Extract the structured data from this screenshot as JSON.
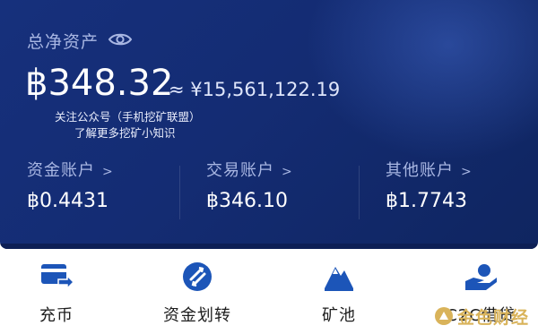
{
  "summary": {
    "total_label": "总净资产",
    "balance": "฿348.32",
    "approx_value": "≈ ¥15,561,122.19",
    "note_line1": "关注公众号（手机挖矿联盟）",
    "note_line2": "了解更多挖矿小知识"
  },
  "accounts": [
    {
      "label": "资金账户",
      "value": "฿0.4431"
    },
    {
      "label": "交易账户",
      "value": "฿346.10"
    },
    {
      "label": "其他账户",
      "value": "฿1.7743"
    }
  ],
  "actions": [
    {
      "label": "充币",
      "icon": "deposit-icon"
    },
    {
      "label": "资金划转",
      "icon": "transfer-icon"
    },
    {
      "label": "矿池",
      "icon": "mining-pool-icon"
    },
    {
      "label": "C2C借贷",
      "icon": "lending-icon"
    }
  ],
  "watermark": {
    "text": "金色财经"
  },
  "colors": {
    "card": "#16307c",
    "icon": "#1c55b8",
    "watermark": "#d9b35a"
  }
}
